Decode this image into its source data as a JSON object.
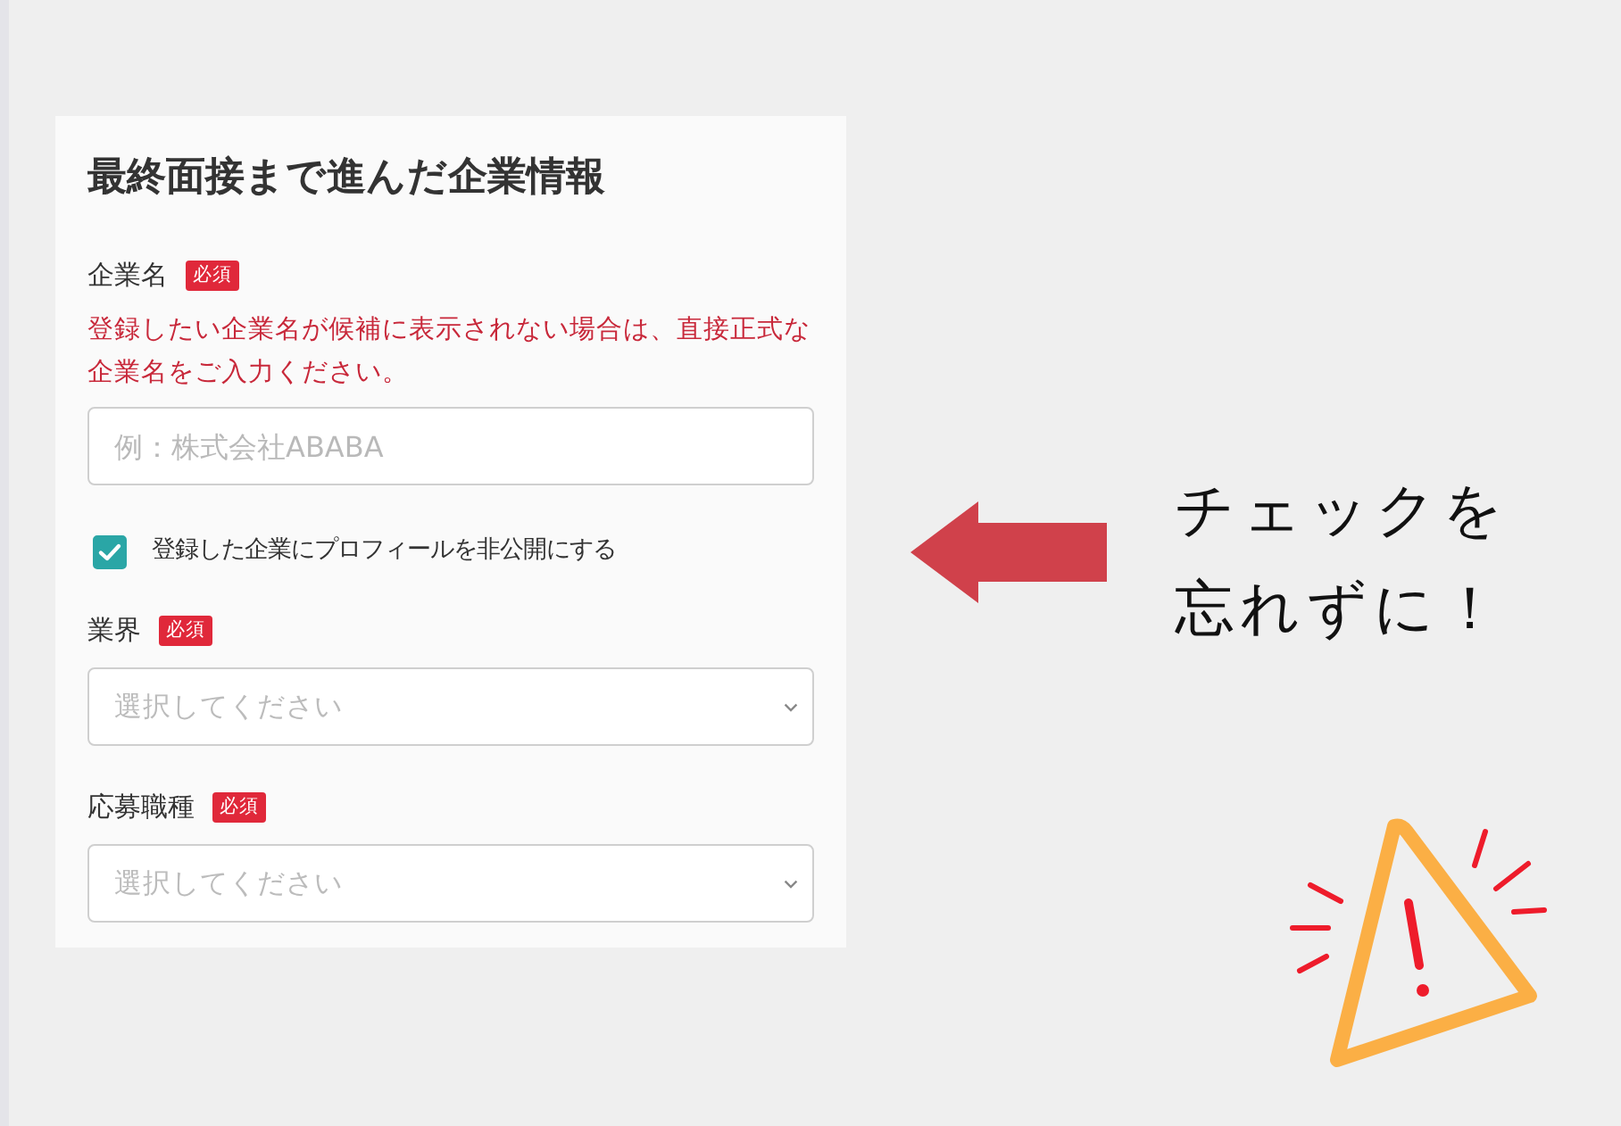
{
  "form": {
    "title": "最終面接まで進んだ企業情報",
    "fields": [
      {
        "kind": "text",
        "label": "企業名",
        "badge": "必須",
        "note": "登録したい企業名が候補に表示されない場合は、直接正式な企業名をご入力ください。",
        "placeholder": "例：株式会社ABABA"
      },
      {
        "kind": "checkbox",
        "label": "登録した企業にプロフィールを非公開にする",
        "checked": true
      },
      {
        "kind": "select",
        "label": "業界",
        "badge": "必須",
        "placeholder": "選択してください"
      },
      {
        "kind": "select",
        "label": "応募職種",
        "badge": "必須",
        "placeholder": "選択してください"
      }
    ]
  },
  "callout": {
    "lines": [
      "チェックを",
      "忘れずに！"
    ]
  }
}
